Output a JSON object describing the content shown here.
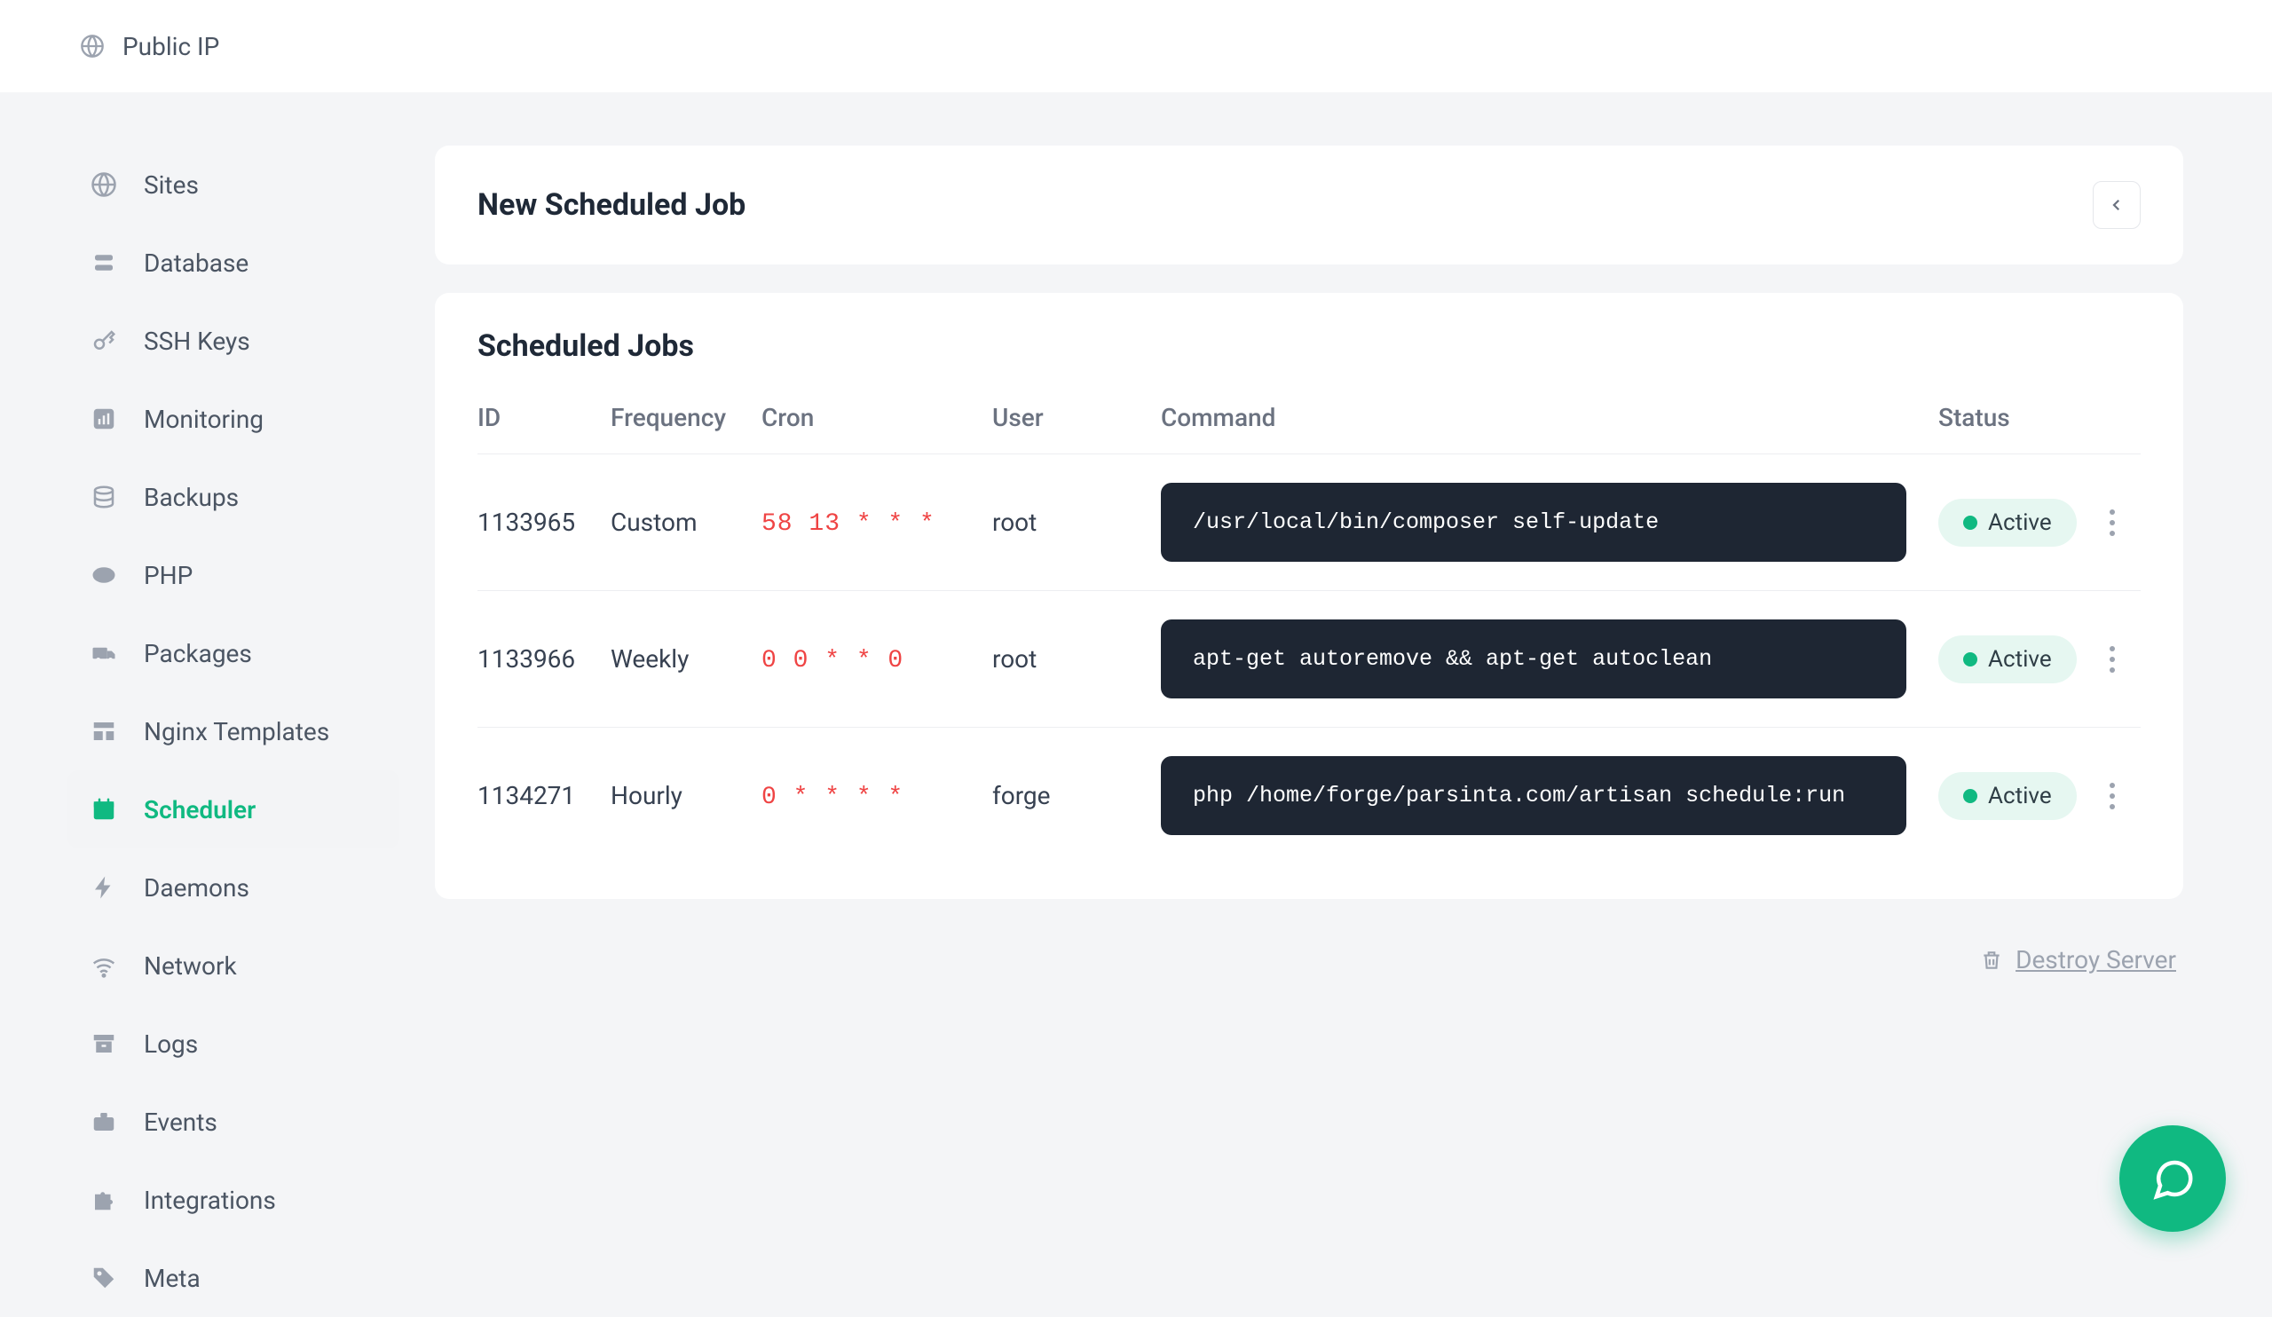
{
  "topbar": {
    "public_ip_label": "Public IP"
  },
  "sidebar": {
    "items": [
      {
        "label": "Sites"
      },
      {
        "label": "Database"
      },
      {
        "label": "SSH Keys"
      },
      {
        "label": "Monitoring"
      },
      {
        "label": "Backups"
      },
      {
        "label": "PHP"
      },
      {
        "label": "Packages"
      },
      {
        "label": "Nginx Templates"
      },
      {
        "label": "Scheduler"
      },
      {
        "label": "Daemons"
      },
      {
        "label": "Network"
      },
      {
        "label": "Logs"
      },
      {
        "label": "Events"
      },
      {
        "label": "Integrations"
      },
      {
        "label": "Meta"
      }
    ]
  },
  "new_job": {
    "title": "New Scheduled Job"
  },
  "jobs": {
    "title": "Scheduled Jobs",
    "columns": {
      "id": "ID",
      "frequency": "Frequency",
      "cron": "Cron",
      "user": "User",
      "command": "Command",
      "status": "Status"
    },
    "rows": [
      {
        "id": "1133965",
        "frequency": "Custom",
        "cron": "58 13 * * *",
        "user": "root",
        "command": "/usr/local/bin/composer self-update",
        "status": "Active"
      },
      {
        "id": "1133966",
        "frequency": "Weekly",
        "cron": "0 0 * * 0",
        "user": "root",
        "command": "apt-get autoremove && apt-get autoclean",
        "status": "Active"
      },
      {
        "id": "1134271",
        "frequency": "Hourly",
        "cron": "0 * * * *",
        "user": "forge",
        "command": "php /home/forge/parsinta.com/artisan schedule:run",
        "status": "Active"
      }
    ]
  },
  "destroy": {
    "label": "Destroy Server"
  }
}
